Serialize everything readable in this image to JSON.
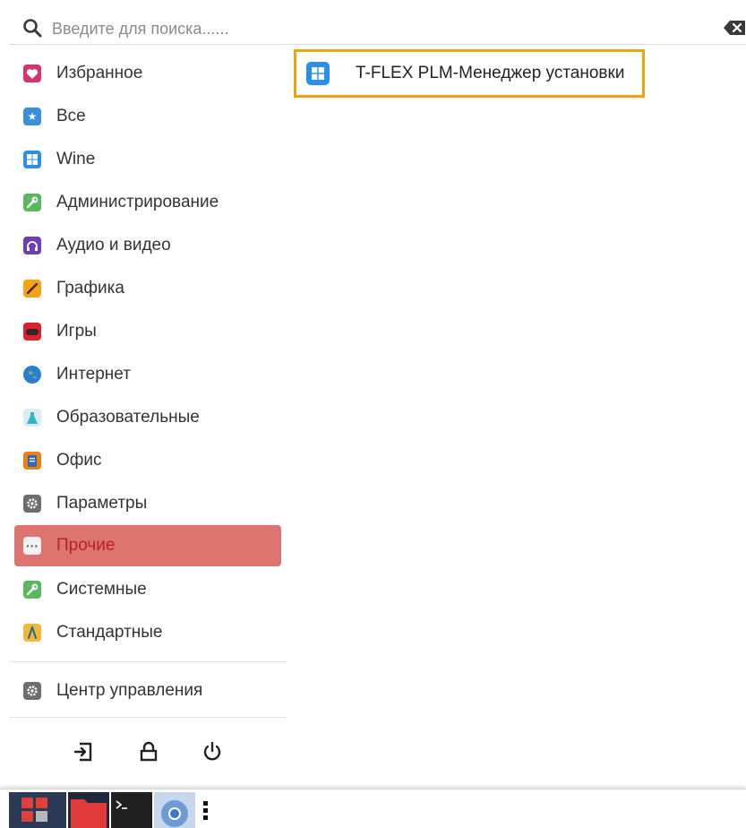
{
  "search": {
    "placeholder": "Введите для поиска......"
  },
  "categories": [
    {
      "label": "Избранное",
      "icon": "heart-icon",
      "color": "#d6336c"
    },
    {
      "label": "Все",
      "icon": "star-icon",
      "color": "#3a8fd9"
    },
    {
      "label": "Wine",
      "icon": "windows-icon",
      "color": "#2a8fe8"
    },
    {
      "label": "Администрирование",
      "icon": "wrench-icon",
      "color": "#5cb85c"
    },
    {
      "label": "Аудио и видео",
      "icon": "headphones-icon",
      "color": "#6f3fb0"
    },
    {
      "label": "Графика",
      "icon": "pencil-icon",
      "color": "#f3a21a"
    },
    {
      "label": "Игры",
      "icon": "gamepad-icon",
      "color": "#e0202e"
    },
    {
      "label": "Интернет",
      "icon": "globe-icon",
      "color": "#2a7fd4"
    },
    {
      "label": "Образовательные",
      "icon": "flask-icon",
      "color": "#2fb8c7"
    },
    {
      "label": "Офис",
      "icon": "document-icon",
      "color": "#f07f12"
    },
    {
      "label": "Параметры",
      "icon": "settings-gear-icon",
      "color": "#6e6e6e"
    },
    {
      "label": "Прочие",
      "icon": "more-dots-icon",
      "color": "#c7c7c7",
      "active": true
    },
    {
      "label": "Системные",
      "icon": "wrench-icon",
      "color": "#5cb85c"
    },
    {
      "label": "Стандартные",
      "icon": "compass-icon",
      "color": "#f2b63a"
    }
  ],
  "control_center": {
    "label": "Центр управления",
    "icon": "settings-gear-icon"
  },
  "result": {
    "label": "T-FLEX PLM-Менеджер установки",
    "icon": "windows-icon"
  },
  "session": [
    "logout-icon",
    "lock-icon",
    "power-icon"
  ],
  "taskbar": [
    "start-menu-icon",
    "file-manager-icon",
    "terminal-icon",
    "chromium-icon",
    "more-vertical-icon"
  ],
  "colors": {
    "accent": "#f1a20f",
    "active_bg": "#de7470",
    "active_text": "#b5202a"
  }
}
